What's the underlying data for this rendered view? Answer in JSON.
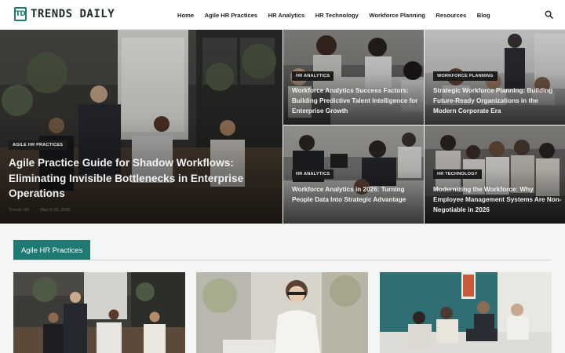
{
  "brand": {
    "mark": "TD",
    "name": "TRENDS DAILY",
    "accent": "#1f7a74"
  },
  "nav": {
    "items": [
      {
        "label": "Home"
      },
      {
        "label": "Agile HR Practices"
      },
      {
        "label": "HR Analytics"
      },
      {
        "label": "HR Technology"
      },
      {
        "label": "Workforce Planning"
      },
      {
        "label": "Resources"
      },
      {
        "label": "Blog"
      }
    ],
    "search_icon": "search-icon"
  },
  "hero": {
    "main": {
      "category": "AGILE HR PRACTICES",
      "title": "Agile Practice Guide for Shadow Workflows: Eliminating Invisible Bottlenecks in Enterprise Operations",
      "author": "Trends HR",
      "date": "March 20, 2026"
    },
    "side": [
      {
        "category": "HR ANALYTICS",
        "title": "Workforce Analytics Success Factors: Building Predictive Talent Intelligence for Enterprise Growth"
      },
      {
        "category": "WORKFORCE PLANNING",
        "title": "Strategic Workforce Planning: Building Future-Ready Organizations in the Modern Corporate Era"
      },
      {
        "category": "HR ANALYTICS",
        "title": "Workforce Analytics in 2026: Turning People Data Into Strategic Advantage"
      },
      {
        "category": "HR TECHNOLOGY",
        "title": "Modernizing the Workforce: Why Employee Management Systems Are Non-Negotiable in 2026"
      }
    ]
  },
  "section": {
    "title": "Agile HR Practices"
  },
  "colors": {
    "accent": "#1f7a74",
    "badge_bg": "#1c1c1c",
    "section_bg": "#f4f5f5"
  }
}
